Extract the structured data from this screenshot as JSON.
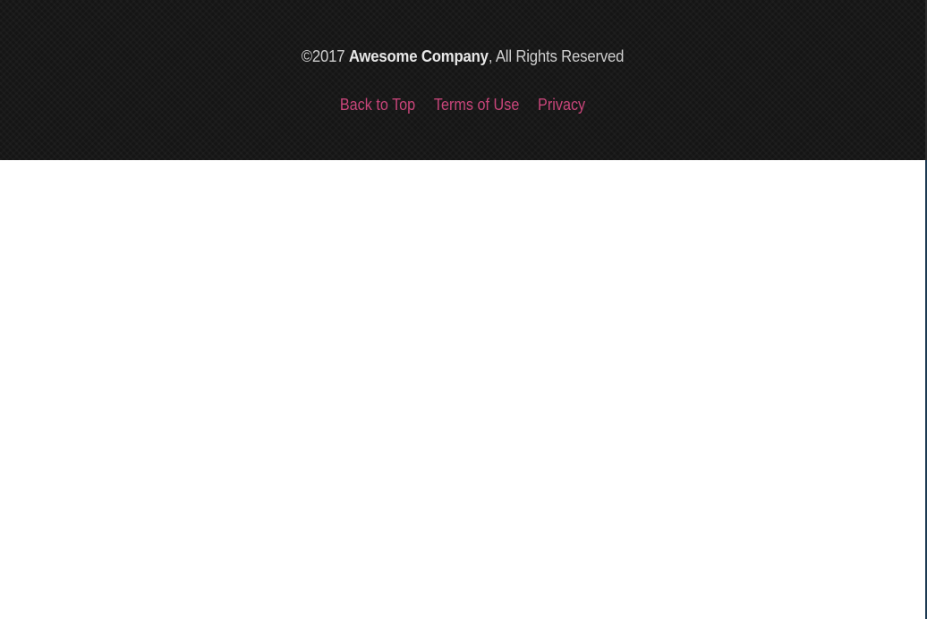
{
  "footer": {
    "copyright_prefix": "©2017 ",
    "company_name": "Awesome Company",
    "copyright_suffix": ", All Rights Reserved",
    "links": [
      {
        "label": "Back to Top"
      },
      {
        "label": "Terms of Use"
      },
      {
        "label": "Privacy"
      }
    ],
    "link_color": "#c8457a",
    "background_color": "#151515"
  }
}
